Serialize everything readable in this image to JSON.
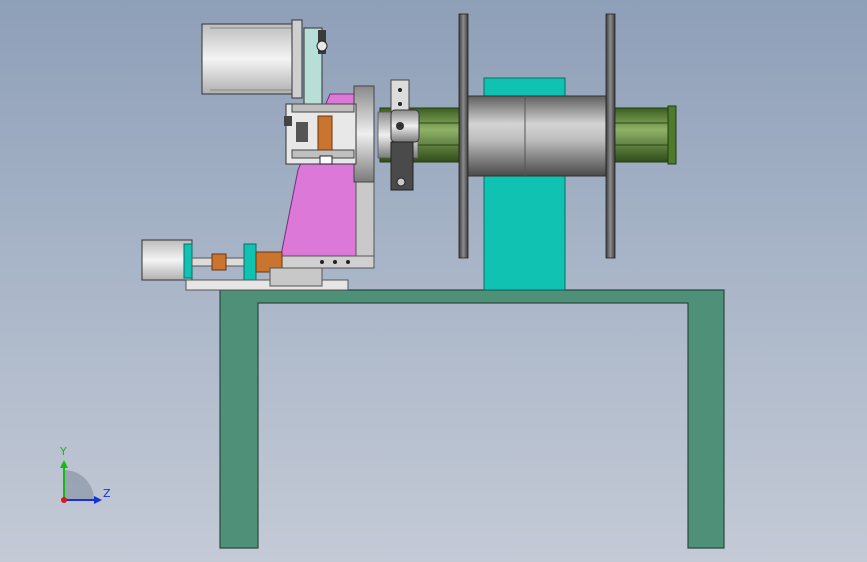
{
  "viewport": {
    "background_top": "#8e9fb8",
    "background_bottom": "#c4cad6"
  },
  "model": {
    "colors": {
      "frame": "#4f9078",
      "frame_edge": "#2a4a3e",
      "pillar": "#10c2b2",
      "plate_pink": "#db78d8",
      "motor_body": "#e4e4e4",
      "shaft_green": "#4e7a2c",
      "drum_gray": "#9a9a9a",
      "coupling_orange": "#d2743a"
    }
  },
  "triad": {
    "y_label": "Y",
    "z_label": "Z",
    "y_color": "#18b818",
    "z_color": "#1830d8",
    "x_color": "#d81818"
  }
}
